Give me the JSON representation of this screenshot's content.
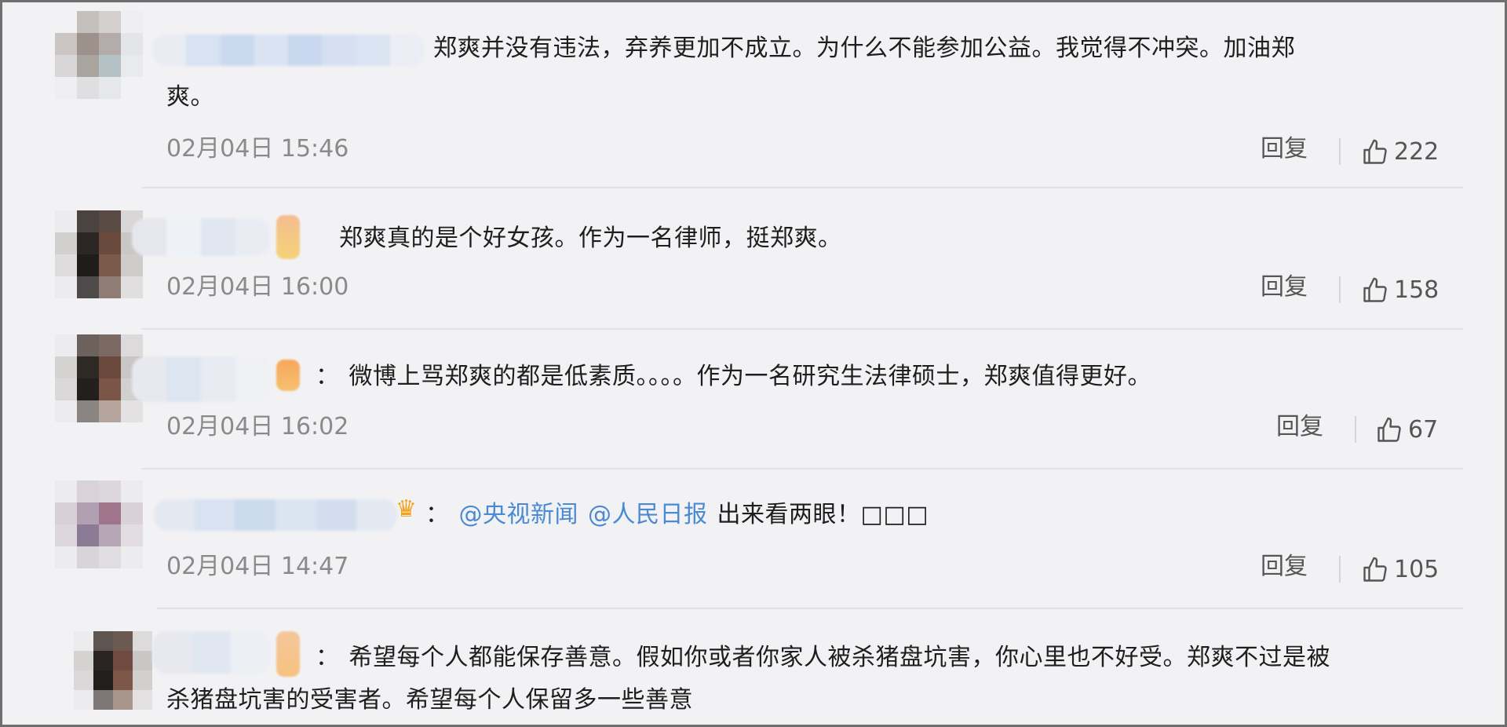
{
  "colors": {
    "background": "#f2f2f5",
    "text": "#1e1e1e",
    "mention": "#4a8ad2",
    "muted": "#8a8a8a",
    "divider": "#e2e2e6"
  },
  "comments": [
    {
      "text": "郑爽并没有违法，弃养更加不成立。为什么不能参加公益。我觉得不冲突。加油郑",
      "text_line2": "爽。",
      "time": "02月04日 15:46",
      "reply_label": "回复",
      "likes": "222",
      "like_icon": "thumbs-up-icon"
    },
    {
      "text": "郑爽真的是个好女孩。作为一名律师，挺郑爽。",
      "time": "02月04日 16:00",
      "reply_label": "回复",
      "likes": "158",
      "like_icon": "thumbs-up-icon"
    },
    {
      "colon": "：",
      "text": "微博上骂郑爽的都是低素质。。。。作为一名研究生法律硕士，郑爽值得更好。",
      "time": "02月04日 16:02",
      "reply_label": "回复",
      "likes": "67",
      "like_icon": "thumbs-up-icon"
    },
    {
      "colon": "：",
      "mention1": "@央视新闻",
      "mention2": "@人民日报",
      "text": "出来看两眼！□□□",
      "time": "02月04日 14:47",
      "reply_label": "回复",
      "likes": "105",
      "like_icon": "thumbs-up-icon",
      "badge_icon": "crown-icon"
    },
    {
      "colon": "：",
      "text": "希望每个人都能保存善意。假如你或者你家人被杀猪盘坑害，你心里也不好受。郑爽不过是被",
      "text_line2": "杀猪盘坑害的受害者。希望每个人保留多一些善意"
    }
  ]
}
